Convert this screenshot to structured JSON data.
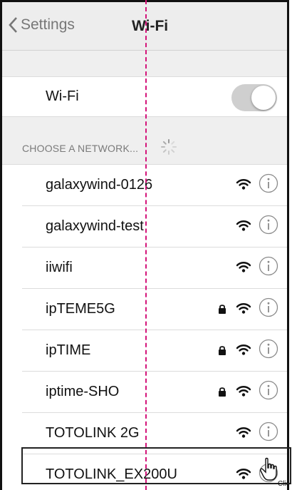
{
  "navbar": {
    "back_label": "Settings",
    "title": "Wi-Fi"
  },
  "wifi_toggle": {
    "label": "Wi-Fi",
    "state": "on"
  },
  "section": {
    "header": "CHOOSE A NETWORK..."
  },
  "networks": [
    {
      "name": "galaxywind-0126",
      "secured": false
    },
    {
      "name": "galaxywind-test",
      "secured": false
    },
    {
      "name": "iiwifi",
      "secured": false
    },
    {
      "name": "ipTEME5G",
      "secured": true
    },
    {
      "name": "ipTIME",
      "secured": true
    },
    {
      "name": "iptime-SHO",
      "secured": true
    },
    {
      "name": "TOTOLINK 2G",
      "secured": false
    },
    {
      "name": "TOTOLINK_EX200U",
      "secured": false,
      "highlighted": true
    }
  ],
  "cursor_label": "Clic",
  "colors": {
    "dash_line": "#d4147a",
    "group_bg": "#efefef",
    "toggle_track": "#cfcfcf"
  },
  "icons": [
    "chevron-left-icon",
    "spinner-icon",
    "wifi-icon",
    "lock-icon",
    "info-icon",
    "hand-cursor-icon"
  ]
}
